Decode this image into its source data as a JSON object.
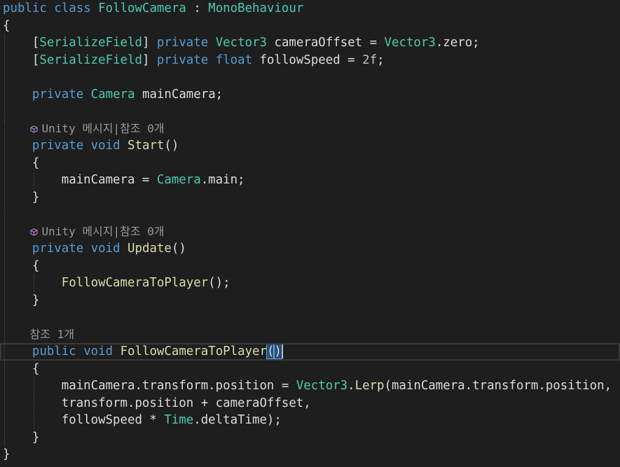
{
  "editor": {
    "lines": [
      {
        "kind": "code",
        "tokens": [
          {
            "t": "public",
            "c": "kw"
          },
          {
            "t": " ",
            "c": "punc"
          },
          {
            "t": "class",
            "c": "kw"
          },
          {
            "t": " ",
            "c": "punc"
          },
          {
            "t": "FollowCamera",
            "c": "type"
          },
          {
            "t": " : ",
            "c": "punc"
          },
          {
            "t": "MonoBehaviour",
            "c": "type"
          }
        ]
      },
      {
        "kind": "code",
        "tokens": [
          {
            "t": "{",
            "c": "punc"
          }
        ]
      },
      {
        "kind": "code",
        "tokens": [
          {
            "t": "    ",
            "c": "punc"
          },
          {
            "t": "[",
            "c": "punc"
          },
          {
            "t": "SerializeField",
            "c": "type"
          },
          {
            "t": "] ",
            "c": "punc"
          },
          {
            "t": "private",
            "c": "kw"
          },
          {
            "t": " ",
            "c": "punc"
          },
          {
            "t": "Vector3",
            "c": "type"
          },
          {
            "t": " cameraOffset = ",
            "c": "ident"
          },
          {
            "t": "Vector3",
            "c": "type"
          },
          {
            "t": ".zero;",
            "c": "ident"
          }
        ]
      },
      {
        "kind": "code",
        "tokens": [
          {
            "t": "    ",
            "c": "punc"
          },
          {
            "t": "[",
            "c": "punc"
          },
          {
            "t": "SerializeField",
            "c": "type"
          },
          {
            "t": "] ",
            "c": "punc"
          },
          {
            "t": "private",
            "c": "kw"
          },
          {
            "t": " ",
            "c": "punc"
          },
          {
            "t": "float",
            "c": "kw"
          },
          {
            "t": " followSpeed = ",
            "c": "ident"
          },
          {
            "t": "2f",
            "c": "num"
          },
          {
            "t": ";",
            "c": "punc"
          }
        ]
      },
      {
        "kind": "code",
        "tokens": []
      },
      {
        "kind": "code",
        "tokens": [
          {
            "t": "    ",
            "c": "punc"
          },
          {
            "t": "private",
            "c": "kw"
          },
          {
            "t": " ",
            "c": "punc"
          },
          {
            "t": "Camera",
            "c": "type"
          },
          {
            "t": " mainCamera;",
            "c": "ident"
          }
        ]
      },
      {
        "kind": "code",
        "tokens": []
      },
      {
        "kind": "lens",
        "text": "Unity 메시지|참조 0개",
        "icon": "unity-cube-icon"
      },
      {
        "kind": "code",
        "tokens": [
          {
            "t": "    ",
            "c": "punc"
          },
          {
            "t": "private",
            "c": "kw"
          },
          {
            "t": " ",
            "c": "punc"
          },
          {
            "t": "void",
            "c": "kw"
          },
          {
            "t": " ",
            "c": "punc"
          },
          {
            "t": "Start",
            "c": "method"
          },
          {
            "t": "()",
            "c": "punc"
          }
        ]
      },
      {
        "kind": "code",
        "tokens": [
          {
            "t": "    {",
            "c": "punc"
          }
        ]
      },
      {
        "kind": "code",
        "tokens": [
          {
            "t": "        mainCamera = ",
            "c": "ident"
          },
          {
            "t": "Camera",
            "c": "type"
          },
          {
            "t": ".main;",
            "c": "ident"
          }
        ]
      },
      {
        "kind": "code",
        "tokens": [
          {
            "t": "    }",
            "c": "punc"
          }
        ]
      },
      {
        "kind": "code",
        "tokens": []
      },
      {
        "kind": "lens",
        "text": "Unity 메시지|참조 0개",
        "icon": "unity-cube-icon"
      },
      {
        "kind": "code",
        "tokens": [
          {
            "t": "    ",
            "c": "punc"
          },
          {
            "t": "private",
            "c": "kw"
          },
          {
            "t": " ",
            "c": "punc"
          },
          {
            "t": "void",
            "c": "kw"
          },
          {
            "t": " ",
            "c": "punc"
          },
          {
            "t": "Update",
            "c": "method"
          },
          {
            "t": "()",
            "c": "punc"
          }
        ]
      },
      {
        "kind": "code",
        "tokens": [
          {
            "t": "    {",
            "c": "punc"
          }
        ]
      },
      {
        "kind": "code",
        "tokens": [
          {
            "t": "        ",
            "c": "punc"
          },
          {
            "t": "FollowCameraToPlayer",
            "c": "method"
          },
          {
            "t": "();",
            "c": "punc"
          }
        ]
      },
      {
        "kind": "code",
        "tokens": [
          {
            "t": "    }",
            "c": "punc"
          }
        ]
      },
      {
        "kind": "code",
        "tokens": []
      },
      {
        "kind": "lens",
        "text": "참조 1개",
        "icon": ""
      },
      {
        "kind": "code",
        "current": true,
        "tokens": [
          {
            "t": "    ",
            "c": "punc"
          },
          {
            "t": "public",
            "c": "kw"
          },
          {
            "t": " ",
            "c": "punc"
          },
          {
            "t": "void",
            "c": "kw"
          },
          {
            "t": " ",
            "c": "punc"
          },
          {
            "t": "FollowCameraToPlayer",
            "c": "method"
          },
          {
            "t": "(",
            "c": "paren-hl"
          },
          {
            "t": ")",
            "c": "paren-hl"
          }
        ]
      },
      {
        "kind": "code",
        "tokens": [
          {
            "t": "    {",
            "c": "punc"
          }
        ]
      },
      {
        "kind": "code",
        "tokens": [
          {
            "t": "        mainCamera.transform.position = ",
            "c": "ident"
          },
          {
            "t": "Vector3",
            "c": "type"
          },
          {
            "t": ".",
            "c": "punc"
          },
          {
            "t": "Lerp",
            "c": "method"
          },
          {
            "t": "(mainCamera.transform.position,",
            "c": "ident"
          }
        ]
      },
      {
        "kind": "code",
        "tokens": [
          {
            "t": "        transform.position + cameraOffset,",
            "c": "ident"
          }
        ]
      },
      {
        "kind": "code",
        "tokens": [
          {
            "t": "        followSpeed * ",
            "c": "ident"
          },
          {
            "t": "Time",
            "c": "type"
          },
          {
            "t": ".deltaTime);",
            "c": "ident"
          }
        ]
      },
      {
        "kind": "code",
        "tokens": [
          {
            "t": "    }",
            "c": "punc"
          }
        ]
      },
      {
        "kind": "code",
        "tokens": [
          {
            "t": "}",
            "c": "punc"
          }
        ]
      }
    ]
  },
  "colors": {
    "background": "#1e1e1e",
    "keyword": "#569cd6",
    "type": "#4ec9b0",
    "method": "#dcdcaa",
    "number": "#b5cea8",
    "text": "#dcdcdc",
    "lens": "#999999",
    "bracket_highlight": "#264f78"
  }
}
